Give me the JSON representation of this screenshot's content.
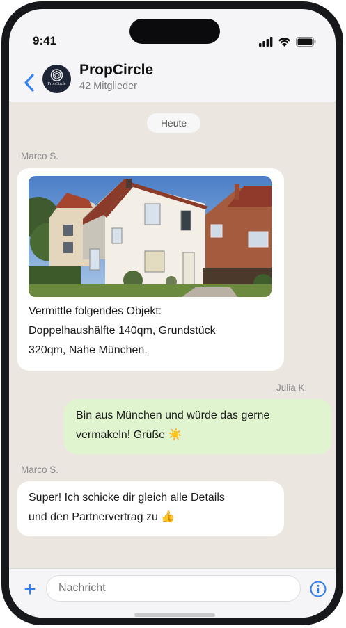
{
  "status_bar": {
    "time": "9:41"
  },
  "header": {
    "title": "PropCircle",
    "members": "42 Mitglieder",
    "avatar_text": "PropCircle"
  },
  "chat": {
    "date_separator": "Heute",
    "messages": [
      {
        "sender": "Marco S.",
        "direction": "incoming",
        "has_photo": true,
        "lines": [
          "Vermittle folgendes Objekt:",
          "Doppelhaushälfte 140qm, Grundstück",
          "320qm, Nähe München."
        ]
      },
      {
        "sender": "Julia K.",
        "direction": "outgoing",
        "lines": [
          "Bin aus München und würde das gerne",
          "vermakeln! Grüße ☀️"
        ]
      },
      {
        "sender": "Marco S.",
        "direction": "incoming",
        "lines": [
          "Super! Ich schicke dir gleich alle Details",
          "und den Partnervertrag zu 👍"
        ]
      }
    ]
  },
  "input_bar": {
    "placeholder": "Nachricht"
  },
  "colors": {
    "accent": "#2f7ff0",
    "incoming_bubble": "#ffffff",
    "outgoing_bubble": "#e0f5cf",
    "chat_background": "#ece6e0"
  },
  "icons": [
    "back-chevron-icon",
    "signal-icon",
    "wifi-icon",
    "battery-icon",
    "plus-icon",
    "info-icon"
  ]
}
